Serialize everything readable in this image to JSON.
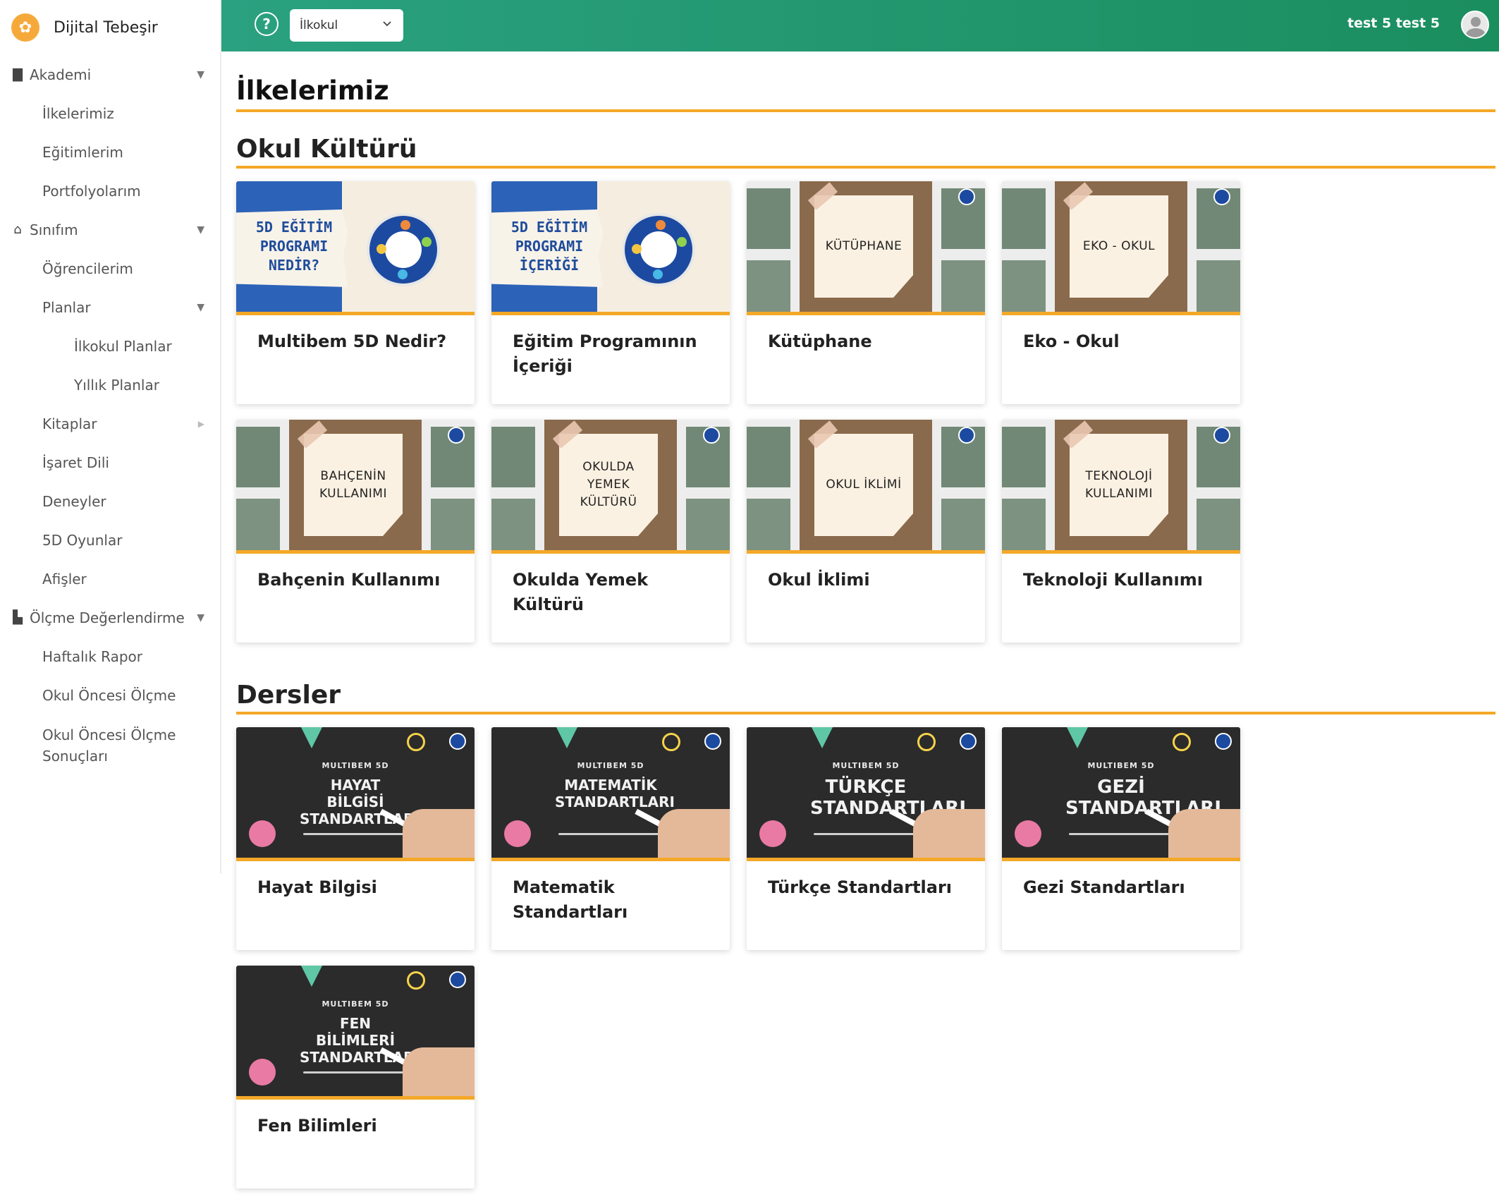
{
  "brand": {
    "name": "Dijital Tebeşir"
  },
  "sidebar": {
    "items": [
      {
        "label": "Akademi",
        "level": 0,
        "icon": "book-icon",
        "caret": "down"
      },
      {
        "label": "İlkelerimiz",
        "level": 1
      },
      {
        "label": "Eğitimlerim",
        "level": 1
      },
      {
        "label": "Portfolyolarım",
        "level": 1
      },
      {
        "label": "Sınıfım",
        "level": 0,
        "icon": "school-icon",
        "caret": "down"
      },
      {
        "label": "Öğrencilerim",
        "level": 1
      },
      {
        "label": "Planlar",
        "level": 1,
        "caret": "down"
      },
      {
        "label": "İlkokul Planlar",
        "level": 2
      },
      {
        "label": "Yıllık Planlar",
        "level": 2
      },
      {
        "label": "Kitaplar",
        "level": 1,
        "caret": "right"
      },
      {
        "label": "İşaret Dili",
        "level": 1
      },
      {
        "label": "Deneyler",
        "level": 1
      },
      {
        "label": "5D Oyunlar",
        "level": 1
      },
      {
        "label": "Afişler",
        "level": 1
      },
      {
        "label": "Ölçme Değerlendirme",
        "level": 0,
        "icon": "chart-icon",
        "caret": "down"
      },
      {
        "label": "Haftalık Rapor",
        "level": 1
      },
      {
        "label": "Okul Öncesi Ölçme",
        "level": 1
      },
      {
        "label": "Okul Öncesi Ölçme Sonuçları",
        "level": 1
      }
    ]
  },
  "header": {
    "select_value": "İlkokul",
    "user_name": "test 5 test 5",
    "accent": "#1f9a6c"
  },
  "page": {
    "title": "İlkelerimiz",
    "accent": "#f4a827",
    "sections": [
      {
        "title": "Okul Kültürü",
        "cards": [
          {
            "label": "Multibem 5D Nedir?",
            "thumb": "brochure",
            "thumb_text": "5D EĞİTİM PROGRAMI NEDİR?"
          },
          {
            "label": "Eğitim Programının İçeriği",
            "thumb": "brochure",
            "thumb_text": "5D EĞİTİM PROGRAMI İÇERİĞİ"
          },
          {
            "label": "Kütüphane",
            "thumb": "cork",
            "thumb_text": "KÜTÜPHANE"
          },
          {
            "label": "Eko - Okul",
            "thumb": "cork",
            "thumb_text": "EKO - OKUL"
          },
          {
            "label": "Bahçenin Kullanımı",
            "thumb": "cork",
            "thumb_text": "BAHÇENİN KULLANIMI"
          },
          {
            "label": "Okulda Yemek Kültürü",
            "thumb": "cork",
            "thumb_text": "OKULDA YEMEK KÜLTÜRÜ"
          },
          {
            "label": "Okul İklimi",
            "thumb": "cork",
            "thumb_text": "OKUL İKLİMİ"
          },
          {
            "label": "Teknoloji Kullanımı",
            "thumb": "cork",
            "thumb_text": "TEKNOLOJİ KULLANIMI"
          }
        ]
      },
      {
        "title": "Dersler",
        "cards": [
          {
            "label": "Hayat Bilgisi",
            "thumb": "chalk",
            "thumb_top": "MULTIBEM 5D",
            "thumb_main": "HAYAT BİLGİSİ STANDARTLARI"
          },
          {
            "label": "Matematik Standartları",
            "thumb": "chalk",
            "thumb_top": "MULTIBEM 5D",
            "thumb_main": "MATEMATİK STANDARTLARI"
          },
          {
            "label": "Türkçe Standartları",
            "thumb": "chalk",
            "thumb_top": "MULTIBEM 5D",
            "thumb_main": "TÜRKÇE STANDARTLARI"
          },
          {
            "label": "Gezi Standartları",
            "thumb": "chalk",
            "thumb_top": "MULTIBEM 5D",
            "thumb_main": "GEZİ STANDARTLARI"
          },
          {
            "label": "Fen Bilimleri",
            "thumb": "chalk",
            "thumb_top": "MULTIBEM 5D",
            "thumb_main": "FEN BİLİMLERİ STANDARTLARI"
          }
        ]
      }
    ]
  }
}
